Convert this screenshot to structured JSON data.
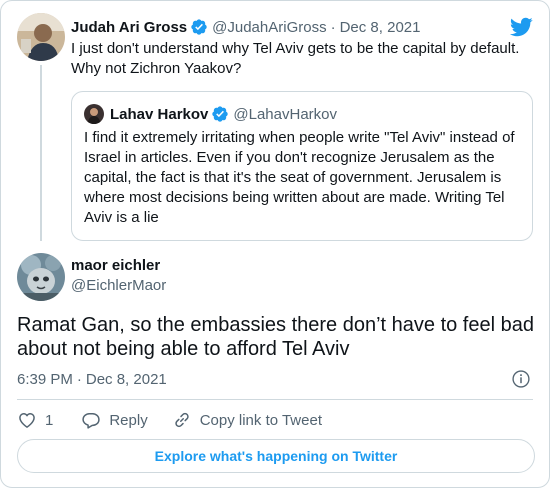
{
  "parent_tweet": {
    "author_name": "Judah Ari Gross",
    "handle": "@JudahAriGross",
    "separator": "·",
    "date": "Dec 8, 2021",
    "text": "I just don't understand why Tel Aviv gets to be the capital by default. Why not Zichron Yaakov?"
  },
  "quoted_tweet": {
    "author_name": "Lahav Harkov",
    "handle": "@LahavHarkov",
    "text": "I find it extremely irritating when people write \"Tel Aviv\" instead of Israel in articles. Even if you don't recognize Jerusalem as the capital, the fact is that it's the seat of government. Jerusalem is where most decisions being written about are made. Writing Tel Aviv is a lie"
  },
  "main_tweet": {
    "author_name": "maor eichler",
    "handle": "@EichlerMaor",
    "text": "Ramat Gan, so the embassies there don’t have to feel bad about not being able to afford Tel Aviv",
    "time": "6:39 PM",
    "separator": "·",
    "date": "Dec 8, 2021"
  },
  "actions": {
    "like_count": "1",
    "reply_label": "Reply",
    "copy_link_label": "Copy link to Tweet"
  },
  "explore_button": {
    "label": "Explore what's happening on Twitter"
  },
  "icons": {
    "brand": "twitter-bird-icon",
    "verified": "verified-badge-icon",
    "like": "heart-icon",
    "reply": "reply-bubble-icon",
    "copy_link": "link-icon",
    "info": "info-icon"
  },
  "colors": {
    "twitter_blue": "#1d9bf0",
    "text_primary": "#0f1419",
    "text_secondary": "#536471",
    "border": "#cfd9de"
  }
}
